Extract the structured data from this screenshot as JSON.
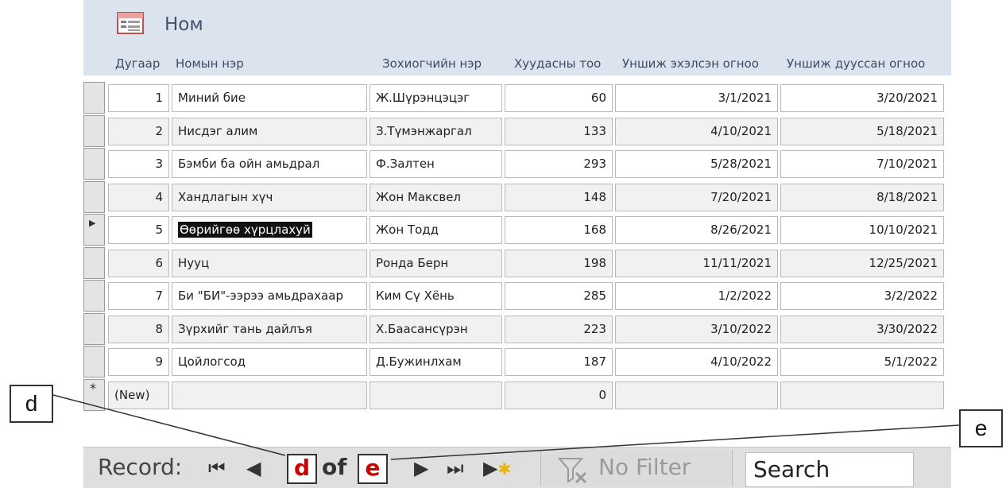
{
  "form": {
    "title": "Ном",
    "title_icon": "form-icon",
    "columns": [
      "Дугаар",
      "Номын нэр",
      "Зохиогчийн нэр",
      "Хуудасны тоо",
      "Уншиж эхэлсэн огноо",
      "Уншиж дууссан огноо"
    ]
  },
  "records": [
    {
      "id": "1",
      "title": "Миний бие",
      "author": "Ж.Шүрэнцэцэг",
      "pages": "60",
      "start": "3/1/2021",
      "end": "3/20/2021"
    },
    {
      "id": "2",
      "title": "Нисдэг алим",
      "author": "З.Түмэнжаргал",
      "pages": "133",
      "start": "4/10/2021",
      "end": "5/18/2021"
    },
    {
      "id": "3",
      "title": "Бэмби ба ойн  амьдрал",
      "author": "Ф.Залтен",
      "pages": "293",
      "start": "5/28/2021",
      "end": "7/10/2021"
    },
    {
      "id": "4",
      "title": "Хандлагын хүч",
      "author": "Жон Максвел",
      "pages": "148",
      "start": "7/20/2021",
      "end": "8/18/2021"
    },
    {
      "id": "5",
      "title": "Өөрийгөө хүрцлахуй",
      "author": "Жон Тодд",
      "pages": "168",
      "start": "8/26/2021",
      "end": "10/10/2021"
    },
    {
      "id": "6",
      "title": "Нууц",
      "author": "Ронда Берн",
      "pages": "198",
      "start": "11/11/2021",
      "end": "12/25/2021"
    },
    {
      "id": "7",
      "title": "Би \"БИ\"-ээрээ амьдрахаар",
      "author": "Ким Сү Хёнь",
      "pages": "285",
      "start": "1/2/2022",
      "end": "3/2/2022"
    },
    {
      "id": "8",
      "title": "Зүрхийг тань дайлъя",
      "author": "Х.Баасансүрэн",
      "pages": "223",
      "start": "3/10/2022",
      "end": "3/30/2022"
    },
    {
      "id": "9",
      "title": "Цойлогсод",
      "author": "Д.Бужинлхам",
      "pages": "187",
      "start": "4/10/2022",
      "end": "5/1/2022"
    }
  ],
  "new_record": {
    "marker": "*",
    "id": "(New)",
    "pages": "0"
  },
  "current_record_marker": "▶",
  "navigation": {
    "label": "Record:",
    "first_icon": "first-record-icon",
    "prev_icon": "previous-record-icon",
    "current": "d",
    "of": "of",
    "total": "e",
    "next_icon": "next-record-icon",
    "last_icon": "last-record-icon",
    "new_icon": "new-record-icon",
    "filter_label": "No Filter",
    "search_label": "Search"
  },
  "callouts": {
    "left": "d",
    "right": "e"
  },
  "colors": {
    "header_bg": "#dbe3ee",
    "highlight": "#cc0000",
    "navbar_bg": "#dfdfdf"
  }
}
